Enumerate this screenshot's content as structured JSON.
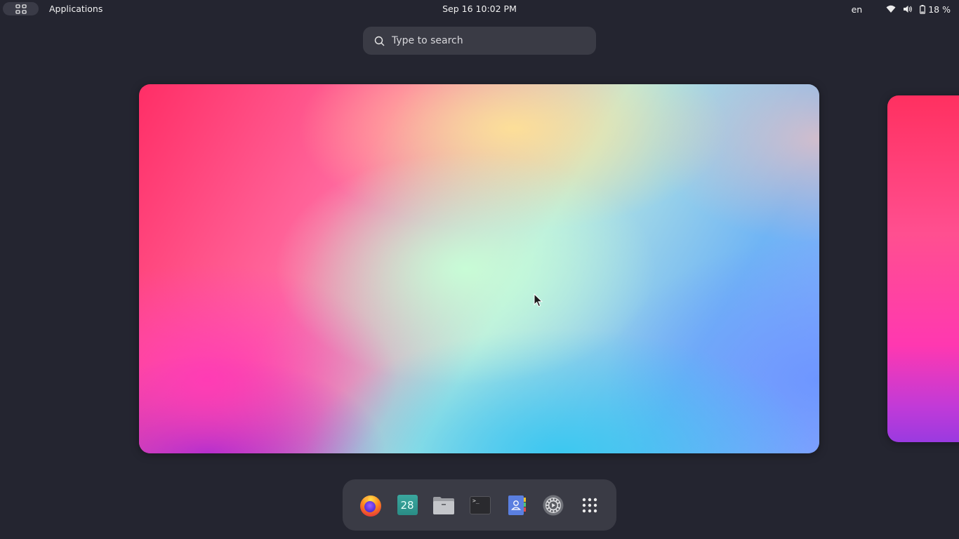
{
  "topbar": {
    "activities_icon": "grid-icon",
    "app_menu_label": "Applications",
    "clock": "Sep 16  10:02 PM",
    "language": "en",
    "wifi_icon": "wifi-icon",
    "volume_icon": "volume-icon",
    "battery_icon": "battery-icon",
    "battery_label": "18 %"
  },
  "search": {
    "placeholder": "Type to search",
    "icon": "search-icon"
  },
  "workspaces": [
    {
      "name": "workspace-1",
      "wallpaper": "gradient"
    },
    {
      "name": "workspace-2",
      "wallpaper": "gradient"
    }
  ],
  "dock": {
    "items": [
      {
        "name": "firefox",
        "icon": "firefox-icon"
      },
      {
        "name": "calendar",
        "icon": "calendar-icon",
        "label": "28"
      },
      {
        "name": "files",
        "icon": "folder-icon"
      },
      {
        "name": "terminal",
        "icon": "terminal-icon",
        "label": ">_"
      },
      {
        "name": "contacts",
        "icon": "contacts-icon"
      },
      {
        "name": "settings",
        "icon": "settings-icon"
      },
      {
        "name": "show-apps",
        "icon": "app-grid-icon"
      }
    ]
  },
  "colors": {
    "background": "#242530",
    "panel": "#3a3b45"
  }
}
